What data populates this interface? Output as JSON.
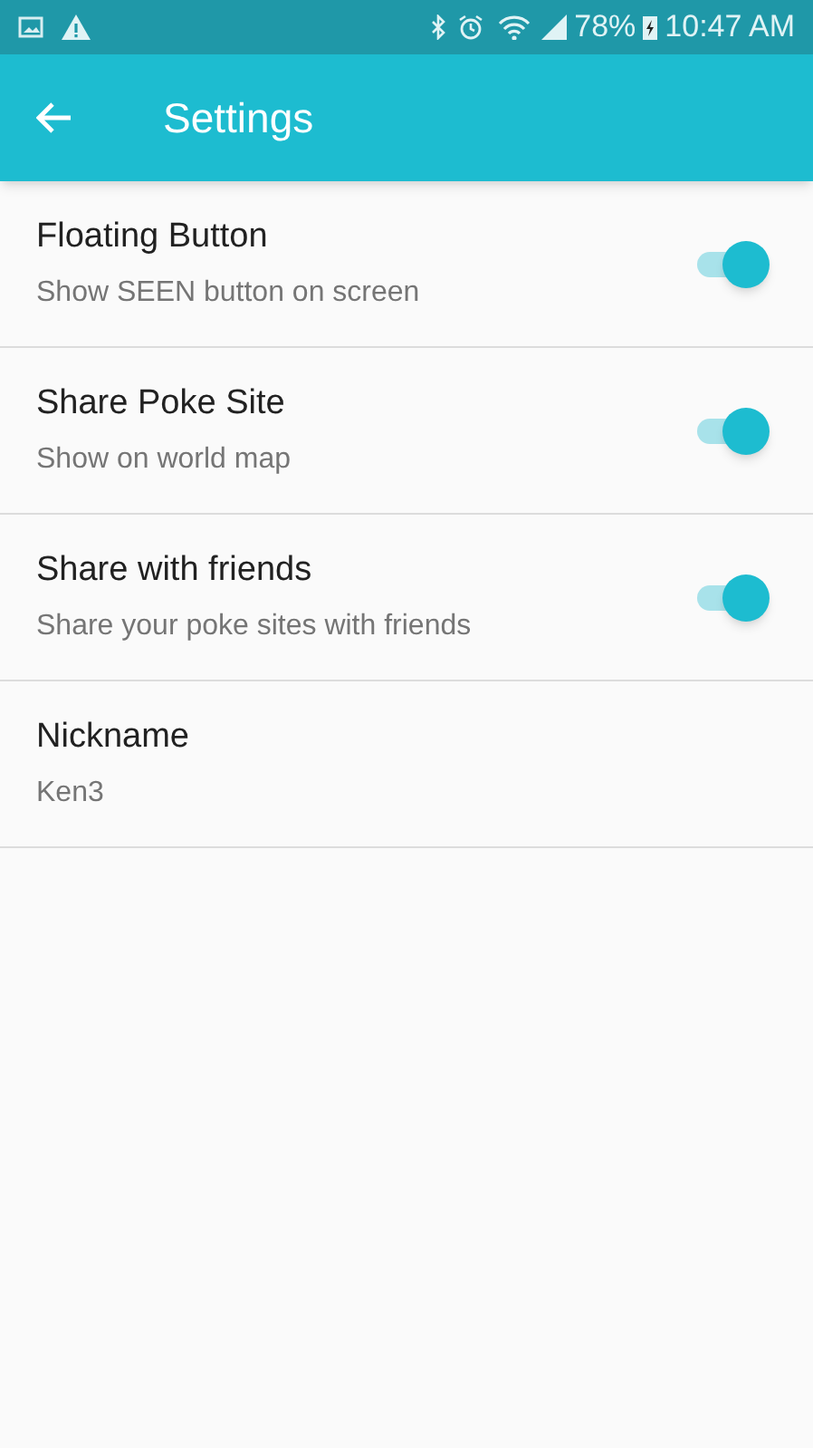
{
  "status_bar": {
    "battery": "78%",
    "time": "10:47 AM"
  },
  "app_bar": {
    "title": "Settings"
  },
  "settings": [
    {
      "kind": "switch",
      "title": "Floating Button",
      "summary": "Show SEEN button on screen",
      "on": true
    },
    {
      "kind": "switch",
      "title": "Share Poke Site",
      "summary": "Show on world map",
      "on": true
    },
    {
      "kind": "switch",
      "title": "Share with friends",
      "summary": "Share your poke sites with friends",
      "on": true
    },
    {
      "kind": "text",
      "title": "Nickname",
      "summary": "Ken3"
    }
  ]
}
